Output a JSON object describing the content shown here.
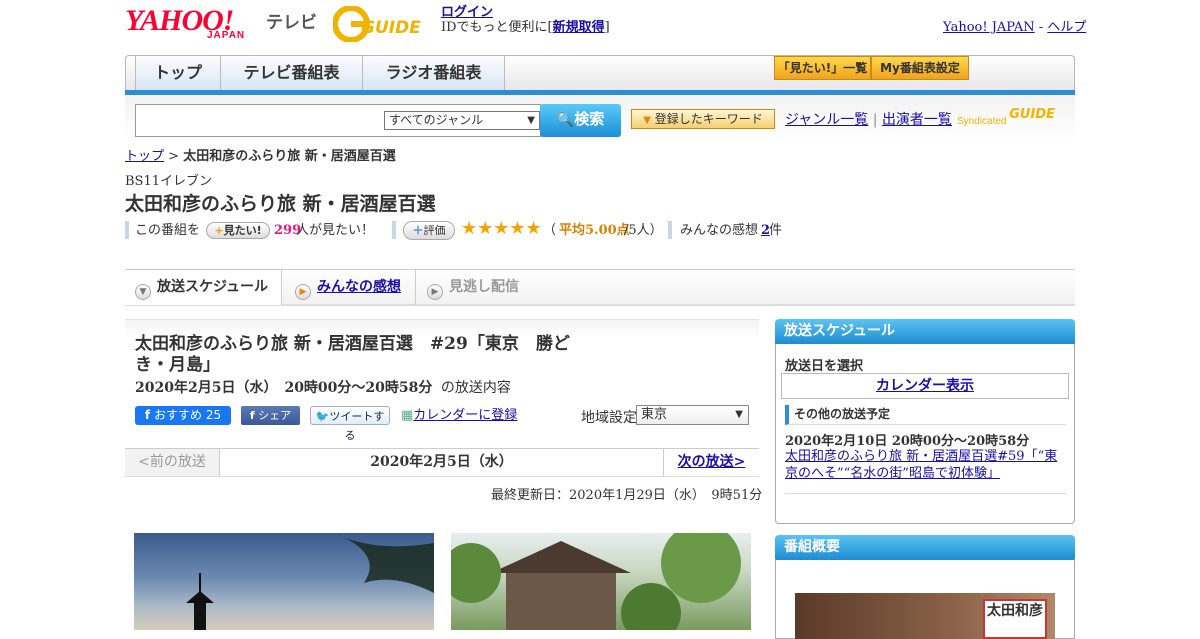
{
  "header": {
    "yahoo_logo": "YAHOO!",
    "yahoo_japan": "JAPAN",
    "tv_label": "テレビ",
    "gguide_logo": "GUIDE",
    "login_link": "ログイン",
    "login_text": "IDでもっと便利に[",
    "signup_link": "新規取得",
    "login_text_end": "]",
    "yahoo_japan_link": "Yahoo! JAPAN",
    "separator": "-",
    "help_link": "ヘルプ"
  },
  "nav": {
    "tabs": [
      "トップ",
      "テレビ番組表",
      "ラジオ番組表"
    ],
    "want_list_button": "「見たい!」一覧",
    "my_guide_button": "My番組表設定"
  },
  "search": {
    "genre_select": "すべてのジャンル",
    "search_button": "検索",
    "keyword_button": "登録したキーワード",
    "genre_list_link": "ジャンル一覧",
    "link_separator": "|",
    "performer_list_link": "出演者一覧",
    "syndicated": "Syndicated",
    "syndicated_logo": "GUIDE"
  },
  "breadcrumb": {
    "home": "トップ",
    "sep": ">",
    "current": "太田和彦のふらり旅 新・居酒屋百選"
  },
  "program": {
    "channel": "BS11イレブン",
    "title": "太田和彦のふらり旅 新・居酒屋百選",
    "want_prefix": "この番組を",
    "want_button": "見たい!",
    "want_count": "299",
    "want_suffix": "人が見たい！",
    "rating_button": "評価",
    "stars": "★★★★★",
    "rating_open": "（",
    "rating_avg": "平均5.00点",
    "rating_count": "/5人）",
    "impression_prefix": "みんなの感想",
    "impression_count": "2",
    "impression_suffix": "件"
  },
  "subtabs": [
    "放送スケジュール",
    "みんなの感想",
    "見逃し配信"
  ],
  "episode": {
    "title": "太田和彦のふらり旅 新・居酒屋百選　#29「東京　勝どき・月島」",
    "datetime": "2020年2月5日（水）　20時00分～20時58分",
    "datetime_suffix": "の放送内容",
    "fb_recommend": "おすすめ",
    "fb_count": "25",
    "fb_share": "シェア",
    "tweet": "ツイートする",
    "calendar_register": "カレンダーに登録",
    "region_label": "地域設定",
    "region_value": "東京",
    "prev_broadcast": "<前の放送",
    "current_date": "2020年2月5日（水）",
    "next_broadcast": "次の放送>",
    "last_updated": "最終更新日：2020年1月29日（水）　9時51分"
  },
  "sidebar": {
    "schedule_header": "放送スケジュール",
    "select_date": "放送日を選択",
    "calendar_button": "カレンダー表示",
    "other_schedule": "その他の放送予定",
    "next_datetime": "2020年2月10日  20時00分～20時58分",
    "next_title": "太田和彦のふらり旅 新・居酒屋百選#59「“東京のへそ”“名水の街”昭島で初体験」",
    "overview_header": "番組概要",
    "overview_sign": "太田和彦"
  }
}
